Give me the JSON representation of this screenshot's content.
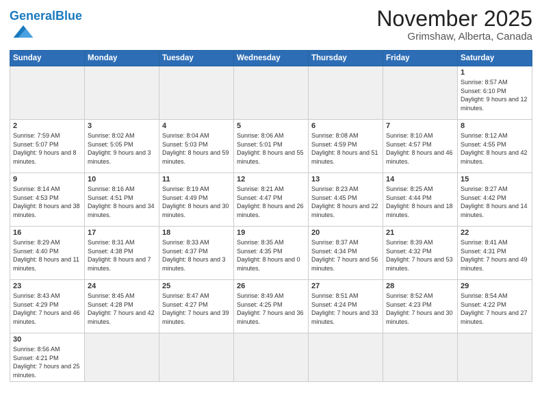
{
  "header": {
    "logo_general": "General",
    "logo_blue": "Blue",
    "title": "November 2025",
    "subtitle": "Grimshaw, Alberta, Canada"
  },
  "weekdays": [
    "Sunday",
    "Monday",
    "Tuesday",
    "Wednesday",
    "Thursday",
    "Friday",
    "Saturday"
  ],
  "weeks": [
    [
      {
        "day": "",
        "info": ""
      },
      {
        "day": "",
        "info": ""
      },
      {
        "day": "",
        "info": ""
      },
      {
        "day": "",
        "info": ""
      },
      {
        "day": "",
        "info": ""
      },
      {
        "day": "",
        "info": ""
      },
      {
        "day": "1",
        "info": "Sunrise: 8:57 AM\nSunset: 6:10 PM\nDaylight: 9 hours and 12 minutes."
      }
    ],
    [
      {
        "day": "2",
        "info": "Sunrise: 7:59 AM\nSunset: 5:07 PM\nDaylight: 9 hours and 8 minutes."
      },
      {
        "day": "3",
        "info": "Sunrise: 8:02 AM\nSunset: 5:05 PM\nDaylight: 9 hours and 3 minutes."
      },
      {
        "day": "4",
        "info": "Sunrise: 8:04 AM\nSunset: 5:03 PM\nDaylight: 8 hours and 59 minutes."
      },
      {
        "day": "5",
        "info": "Sunrise: 8:06 AM\nSunset: 5:01 PM\nDaylight: 8 hours and 55 minutes."
      },
      {
        "day": "6",
        "info": "Sunrise: 8:08 AM\nSunset: 4:59 PM\nDaylight: 8 hours and 51 minutes."
      },
      {
        "day": "7",
        "info": "Sunrise: 8:10 AM\nSunset: 4:57 PM\nDaylight: 8 hours and 46 minutes."
      },
      {
        "day": "8",
        "info": "Sunrise: 8:12 AM\nSunset: 4:55 PM\nDaylight: 8 hours and 42 minutes."
      }
    ],
    [
      {
        "day": "9",
        "info": "Sunrise: 8:14 AM\nSunset: 4:53 PM\nDaylight: 8 hours and 38 minutes."
      },
      {
        "day": "10",
        "info": "Sunrise: 8:16 AM\nSunset: 4:51 PM\nDaylight: 8 hours and 34 minutes."
      },
      {
        "day": "11",
        "info": "Sunrise: 8:19 AM\nSunset: 4:49 PM\nDaylight: 8 hours and 30 minutes."
      },
      {
        "day": "12",
        "info": "Sunrise: 8:21 AM\nSunset: 4:47 PM\nDaylight: 8 hours and 26 minutes."
      },
      {
        "day": "13",
        "info": "Sunrise: 8:23 AM\nSunset: 4:45 PM\nDaylight: 8 hours and 22 minutes."
      },
      {
        "day": "14",
        "info": "Sunrise: 8:25 AM\nSunset: 4:44 PM\nDaylight: 8 hours and 18 minutes."
      },
      {
        "day": "15",
        "info": "Sunrise: 8:27 AM\nSunset: 4:42 PM\nDaylight: 8 hours and 14 minutes."
      }
    ],
    [
      {
        "day": "16",
        "info": "Sunrise: 8:29 AM\nSunset: 4:40 PM\nDaylight: 8 hours and 11 minutes."
      },
      {
        "day": "17",
        "info": "Sunrise: 8:31 AM\nSunset: 4:38 PM\nDaylight: 8 hours and 7 minutes."
      },
      {
        "day": "18",
        "info": "Sunrise: 8:33 AM\nSunset: 4:37 PM\nDaylight: 8 hours and 3 minutes."
      },
      {
        "day": "19",
        "info": "Sunrise: 8:35 AM\nSunset: 4:35 PM\nDaylight: 8 hours and 0 minutes."
      },
      {
        "day": "20",
        "info": "Sunrise: 8:37 AM\nSunset: 4:34 PM\nDaylight: 7 hours and 56 minutes."
      },
      {
        "day": "21",
        "info": "Sunrise: 8:39 AM\nSunset: 4:32 PM\nDaylight: 7 hours and 53 minutes."
      },
      {
        "day": "22",
        "info": "Sunrise: 8:41 AM\nSunset: 4:31 PM\nDaylight: 7 hours and 49 minutes."
      }
    ],
    [
      {
        "day": "23",
        "info": "Sunrise: 8:43 AM\nSunset: 4:29 PM\nDaylight: 7 hours and 46 minutes."
      },
      {
        "day": "24",
        "info": "Sunrise: 8:45 AM\nSunset: 4:28 PM\nDaylight: 7 hours and 42 minutes."
      },
      {
        "day": "25",
        "info": "Sunrise: 8:47 AM\nSunset: 4:27 PM\nDaylight: 7 hours and 39 minutes."
      },
      {
        "day": "26",
        "info": "Sunrise: 8:49 AM\nSunset: 4:25 PM\nDaylight: 7 hours and 36 minutes."
      },
      {
        "day": "27",
        "info": "Sunrise: 8:51 AM\nSunset: 4:24 PM\nDaylight: 7 hours and 33 minutes."
      },
      {
        "day": "28",
        "info": "Sunrise: 8:52 AM\nSunset: 4:23 PM\nDaylight: 7 hours and 30 minutes."
      },
      {
        "day": "29",
        "info": "Sunrise: 8:54 AM\nSunset: 4:22 PM\nDaylight: 7 hours and 27 minutes."
      }
    ],
    [
      {
        "day": "30",
        "info": "Sunrise: 8:56 AM\nSunset: 4:21 PM\nDaylight: 7 hours and 25 minutes."
      },
      {
        "day": "",
        "info": ""
      },
      {
        "day": "",
        "info": ""
      },
      {
        "day": "",
        "info": ""
      },
      {
        "day": "",
        "info": ""
      },
      {
        "day": "",
        "info": ""
      },
      {
        "day": "",
        "info": ""
      }
    ]
  ]
}
